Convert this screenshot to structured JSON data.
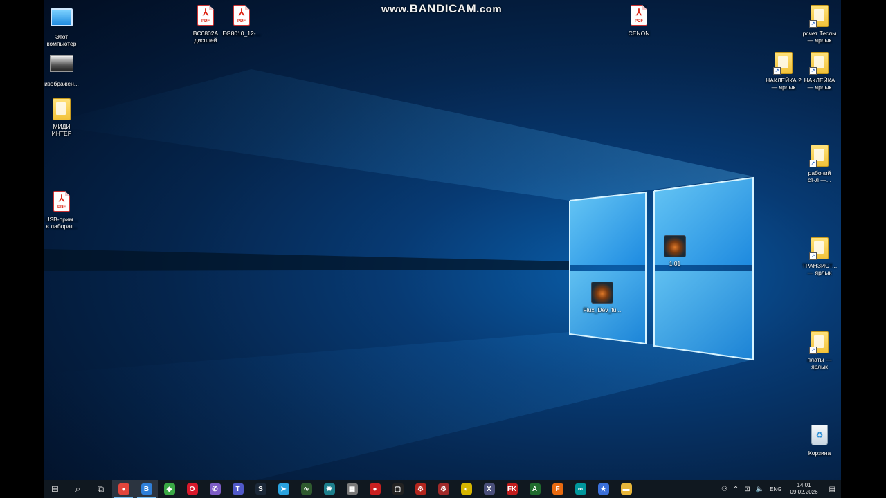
{
  "watermark": {
    "prefix": "www.",
    "brand": "BANDICAM",
    "suffix": ".com"
  },
  "desktop_icons": [
    {
      "id": "this-pc",
      "label": "Этот\nкомпьютер",
      "kind": "pc"
    },
    {
      "id": "images",
      "label": "изображен...",
      "kind": "thumb"
    },
    {
      "id": "midi",
      "label": "МИДИ\nИНТЕР",
      "kind": "folder"
    },
    {
      "id": "usb-pdf",
      "label": "USB-прим...\nв лаборат...",
      "kind": "pdf"
    },
    {
      "id": "bc0802a",
      "label": "BC0802A\nдисплей",
      "kind": "pdf"
    },
    {
      "id": "eg8010",
      "label": "EG8010_12-...",
      "kind": "pdf"
    },
    {
      "id": "cenon",
      "label": "CENON",
      "kind": "pdf"
    },
    {
      "id": "tesla",
      "label": "рсчет Теслы\n— ярлык",
      "kind": "folder"
    },
    {
      "id": "naklejka2",
      "label": "НАКЛЕЙКА 2\n— ярлык",
      "kind": "folder"
    },
    {
      "id": "naklejka",
      "label": "НАКЛЕЙКА\n— ярлык",
      "kind": "folder"
    },
    {
      "id": "work",
      "label": "рабочий\nст-л —...",
      "kind": "folder"
    },
    {
      "id": "transistor",
      "label": "ТРАНЗИСТ...\n— ярлык",
      "kind": "folder"
    },
    {
      "id": "boards",
      "label": "платы —\nярлык",
      "kind": "folder"
    },
    {
      "id": "game1",
      "label": "1.01",
      "kind": "app"
    },
    {
      "id": "flux",
      "label": "Flux_Dev_fu...",
      "kind": "app"
    },
    {
      "id": "recycle",
      "label": "Корзина",
      "kind": "bin"
    }
  ],
  "taskbar": {
    "apps": [
      {
        "name": "start",
        "glyph": "⊞",
        "color": ""
      },
      {
        "name": "search",
        "glyph": "⌕",
        "color": ""
      },
      {
        "name": "task-view",
        "glyph": "⧉",
        "color": ""
      },
      {
        "name": "chrome",
        "glyph": "●",
        "color": "#e2453c"
      },
      {
        "name": "bitrix",
        "glyph": "B",
        "color": "#2f7fd8"
      },
      {
        "name": "green-app",
        "glyph": "◆",
        "color": "#3aa845"
      },
      {
        "name": "opera",
        "glyph": "O",
        "color": "#d8192b"
      },
      {
        "name": "viber",
        "glyph": "✆",
        "color": "#7d5cc6"
      },
      {
        "name": "teams",
        "glyph": "T",
        "color": "#5059c9"
      },
      {
        "name": "steam",
        "glyph": "S",
        "color": "#1b2838"
      },
      {
        "name": "telegram",
        "glyph": "➤",
        "color": "#2aa3df"
      },
      {
        "name": "scope",
        "glyph": "∿",
        "color": "#2f5a2f"
      },
      {
        "name": "gear-app",
        "glyph": "✹",
        "color": "#1d7f8c"
      },
      {
        "name": "calc-app",
        "glyph": "▦",
        "color": "#7a7a7a"
      },
      {
        "name": "record",
        "glyph": "●",
        "color": "#c92020"
      },
      {
        "name": "window-app",
        "glyph": "▢",
        "color": "#222"
      },
      {
        "name": "chip-app",
        "glyph": "⚙",
        "color": "#b3261e"
      },
      {
        "name": "board-app",
        "glyph": "⚙",
        "color": "#a12a2a"
      },
      {
        "name": "yellow-app",
        "glyph": "◐",
        "color": "#d6b500"
      },
      {
        "name": "excel-like",
        "glyph": "X",
        "color": "#4a4f7a"
      },
      {
        "name": "fk-app",
        "glyph": "FK",
        "color": "#c21d1d"
      },
      {
        "name": "a-app",
        "glyph": "A",
        "color": "#1f6b2e"
      },
      {
        "name": "f-app",
        "glyph": "F",
        "color": "#e86a10"
      },
      {
        "name": "arduino",
        "glyph": "∞",
        "color": "#00979c"
      },
      {
        "name": "star-app",
        "glyph": "★",
        "color": "#3a6fd8"
      },
      {
        "name": "explorer",
        "glyph": "▬",
        "color": "#e7b63a"
      }
    ],
    "tray": {
      "lang": "ENG",
      "time": "14:01",
      "date": "09.02.2026"
    }
  }
}
